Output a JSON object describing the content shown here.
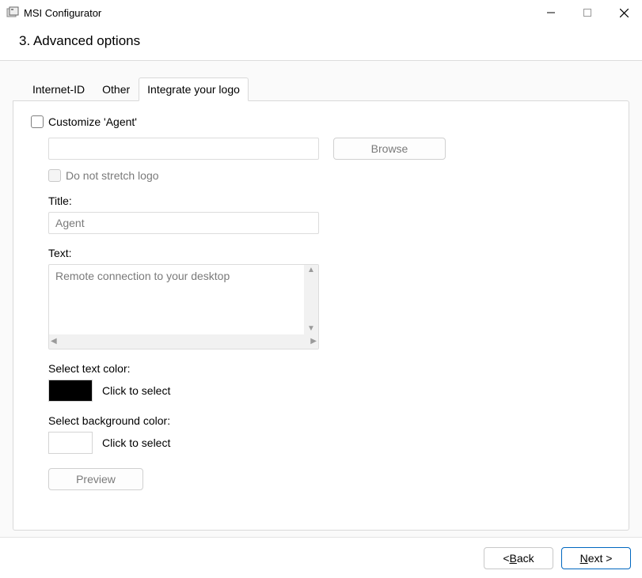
{
  "window": {
    "title": "MSI Configurator"
  },
  "heading": "3. Advanced options",
  "tabs": {
    "internet_id": "Internet-ID",
    "other": "Other",
    "integrate_logo": "Integrate your logo"
  },
  "form": {
    "customize_agent_label": "Customize 'Agent'",
    "logo_path_value": "",
    "browse_label": "Browse",
    "no_stretch_label": "Do not stretch logo",
    "title_label": "Title:",
    "title_value": "Agent",
    "text_label": "Text:",
    "text_value": "Remote connection to your desktop",
    "select_text_color_label": "Select text color:",
    "text_color_swatch": "#000000",
    "click_to_select_label": "Click to select",
    "select_bg_color_label": "Select background color:",
    "bg_color_swatch": "#ffffff",
    "preview_label": "Preview"
  },
  "nav": {
    "back": "< ",
    "back_u": "B",
    "back_rest": "ack",
    "next_u": "N",
    "next_rest": "ext >"
  }
}
